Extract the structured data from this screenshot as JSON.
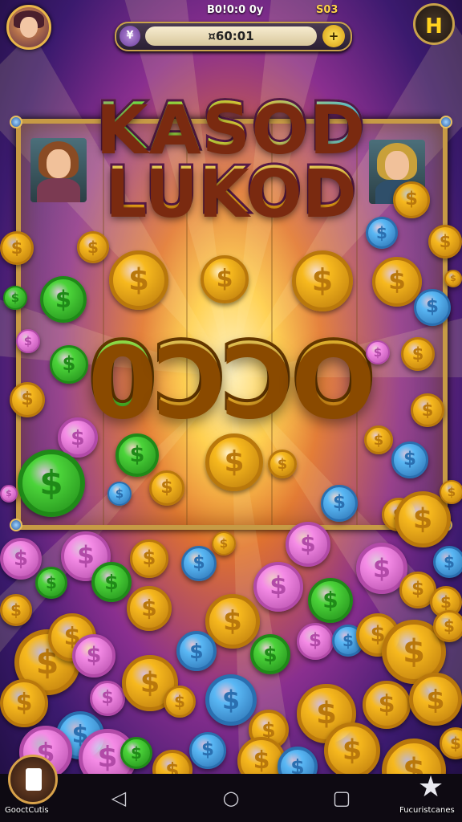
{
  "header": {
    "balance_label": "B0!0:0 0y",
    "currency_label": "S03",
    "balance_value": "¤60:01",
    "pill_icon_glyph": "¥",
    "add_glyph": "+",
    "menu_glyph": "H"
  },
  "game": {
    "title_line1": "KASOD",
    "title_line2": "LUKOD",
    "win_digits": [
      "0",
      "ϽϽ",
      "O"
    ]
  },
  "coin_symbol": "$",
  "bottom": {
    "left_label": "GooctCutis",
    "right_label": "Fucuristcanes",
    "nav_back": "◁",
    "nav_home": "○",
    "nav_recent": "▢",
    "star_glyph": "★"
  },
  "colors": {
    "gold": "#f7b91e",
    "green": "#4cd43a",
    "pink": "#f58be6",
    "blue": "#5ab8f5",
    "frame": "#c79a45"
  }
}
